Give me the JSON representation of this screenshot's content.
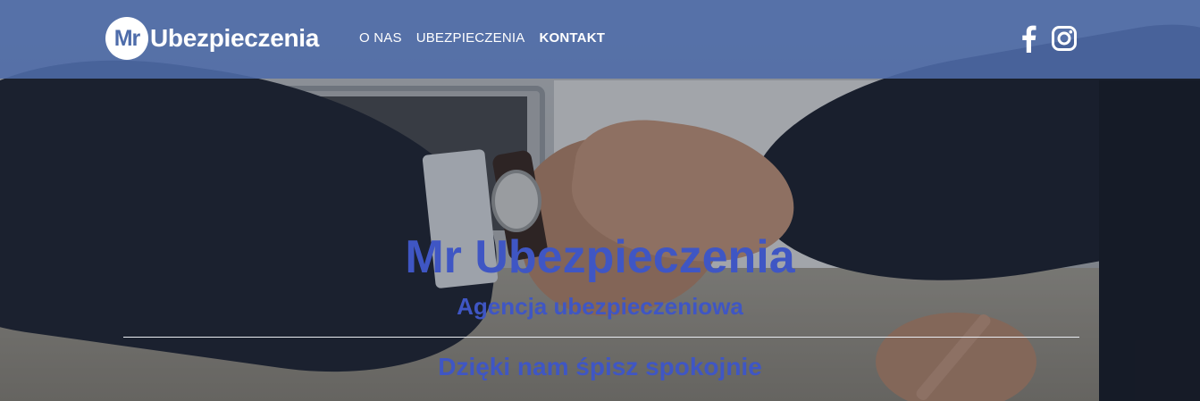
{
  "brand": {
    "logo_mark": "Mr",
    "logo_text": "Ubezpieczenia",
    "color_primary": "#4e6caa",
    "color_heading": "#3f56c4"
  },
  "nav": {
    "items": [
      {
        "label": "O NAS",
        "active": false
      },
      {
        "label": "UBEZPIECZENIA",
        "active": false
      },
      {
        "label": "KONTAKT",
        "active": true
      }
    ]
  },
  "social": {
    "icons": [
      "facebook-icon",
      "instagram-icon"
    ]
  },
  "hero": {
    "title": "Mr Ubezpieczenia",
    "subtitle": "Agencja ubezpieczeniowa",
    "tagline": "Dzięki nam śpisz spokojnie",
    "background": "handshake photo"
  }
}
